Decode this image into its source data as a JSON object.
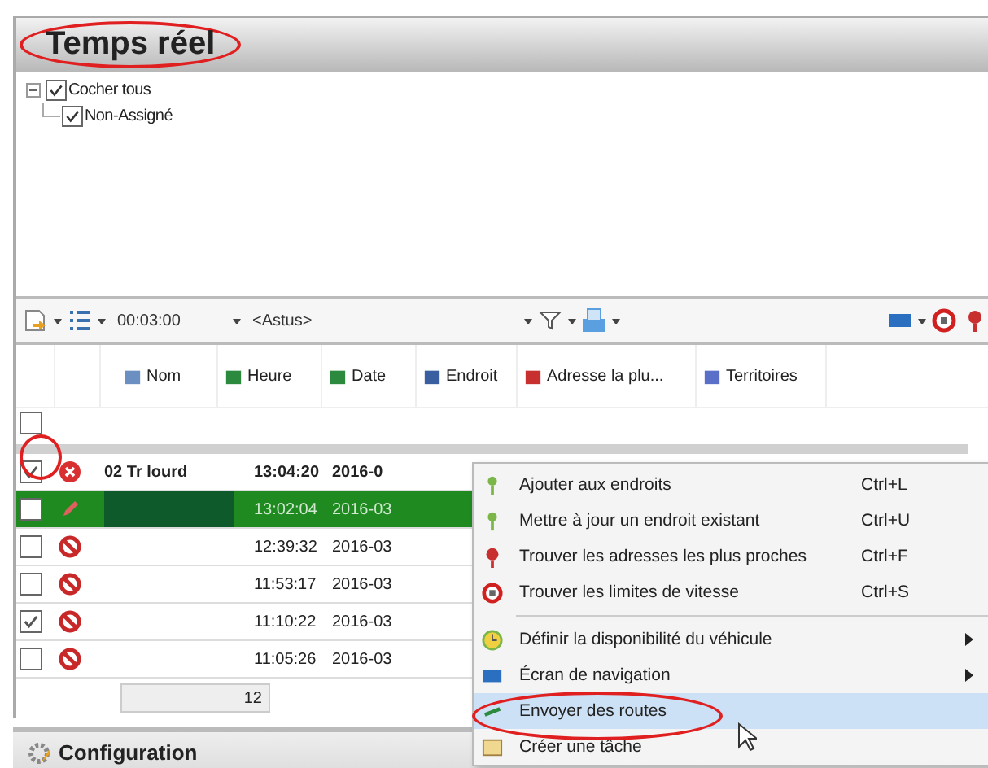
{
  "panel": {
    "title": "Temps réel"
  },
  "tree": [
    {
      "label": "Cocher tous",
      "checked": true,
      "expanded": true,
      "children": [
        {
          "label": "Non-Assigné",
          "checked": true
        }
      ]
    }
  ],
  "toolbar": {
    "interval": "00:03:00",
    "filter": "<Astus>"
  },
  "table": {
    "columns": [
      "Nom",
      "Heure",
      "Date",
      "Endroit",
      "Adresse la plu...",
      "Territoires"
    ],
    "filter_checked": false,
    "rows": [
      {
        "checked": true,
        "kind": "error",
        "name": "02  Tr lourd",
        "time": "13:04:20",
        "date": "2016-0",
        "selected": false,
        "bold": true
      },
      {
        "checked": false,
        "kind": "edit",
        "time": "13:02:04",
        "date": "2016-03",
        "selected": true,
        "bold": false
      },
      {
        "checked": false,
        "kind": "blocked",
        "time": "12:39:32",
        "date": "2016-03",
        "selected": false,
        "bold": false
      },
      {
        "checked": false,
        "kind": "blocked",
        "time": "11:53:17",
        "date": "2016-03",
        "selected": false,
        "bold": false
      },
      {
        "checked": true,
        "kind": "blocked",
        "time": "11:10:22",
        "date": "2016-03",
        "selected": false,
        "bold": false
      },
      {
        "checked": false,
        "kind": "blocked",
        "time": "11:05:26",
        "date": "2016-03",
        "selected": false,
        "bold": false
      }
    ],
    "total": "12"
  },
  "context_menu": {
    "items": [
      {
        "kind": "item",
        "label": "Ajouter aux endroits",
        "shortcut": "Ctrl+L",
        "selected": false
      },
      {
        "kind": "item",
        "label": "Mettre à jour un endroit existant",
        "shortcut": "Ctrl+U",
        "selected": false
      },
      {
        "kind": "item",
        "label": "Trouver les adresses les plus proches",
        "shortcut": "Ctrl+F",
        "selected": false
      },
      {
        "kind": "item",
        "label": "Trouver les limites de vitesse",
        "shortcut": "Ctrl+S",
        "selected": false
      },
      {
        "kind": "separator"
      },
      {
        "kind": "submenu",
        "label": "Définir la disponibilité du véhicule",
        "selected": false
      },
      {
        "kind": "submenu",
        "label": "Écran de navigation",
        "selected": false
      },
      {
        "kind": "item",
        "label": "Envoyer des routes",
        "selected": true
      },
      {
        "kind": "item",
        "label": "Créer une tâche",
        "selected": false
      }
    ]
  },
  "bottom_panel": {
    "title": "Configuration"
  }
}
